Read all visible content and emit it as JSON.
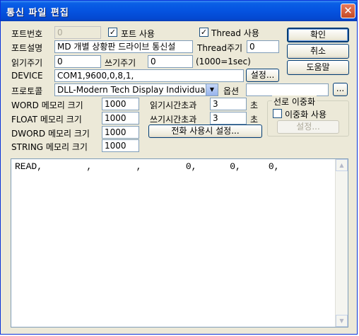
{
  "window": {
    "title": "통신 파일 편집",
    "close_glyph": "✕"
  },
  "port": {
    "number_label": "포트번호",
    "number_value": "0",
    "use_label": "포트 사용",
    "use_checked": true,
    "use_check_glyph": "✓",
    "thread_use_label": "Thread 사용",
    "thread_use_checked": true
  },
  "desc": {
    "label": "포트설명",
    "value": "MD 개별 상황판 드라이브 통신설",
    "thread_period_label": "Thread주기",
    "thread_period_value": "0"
  },
  "cycle": {
    "read_label": "읽기주기",
    "read_value": "0",
    "write_label": "쓰기주기",
    "write_value": "0",
    "hint": "(1000=1sec)"
  },
  "device": {
    "label": "DEVICE",
    "value": "COM1,9600,0,8,1,",
    "settings_button": "설정..."
  },
  "protocol": {
    "label": "프로토콜",
    "value": "DLL-Modern Tech Display Individual",
    "arrow_glyph": "▼",
    "option_label": "옵션",
    "option_value": "",
    "browse_button": "..."
  },
  "memory": {
    "word_label": "WORD 메모리 크기",
    "word_value": "1000",
    "float_label": "FLOAT 메모리 크기",
    "float_value": "1000",
    "dword_label": "DWORD 메모리 크기",
    "dword_value": "1000",
    "string_label": "STRING 메모리 크기",
    "string_value": "1000"
  },
  "timeout": {
    "read_label": "읽기시간초과",
    "read_value": "3",
    "write_label": "쓰기시간초과",
    "write_value": "3",
    "unit": "초"
  },
  "phone_button": "전화 사용시 설정...",
  "redundancy": {
    "title": "선로 이중화",
    "use_label": "이중화 사용",
    "use_checked": false,
    "settings_button": "설정..."
  },
  "buttons": {
    "ok": "확인",
    "cancel": "취소",
    "help": "도움말"
  },
  "editor": {
    "text": "READ,        ,        ,        0,      0,     0,"
  },
  "scroll": {
    "up_glyph": "▲",
    "down_glyph": "▼"
  }
}
